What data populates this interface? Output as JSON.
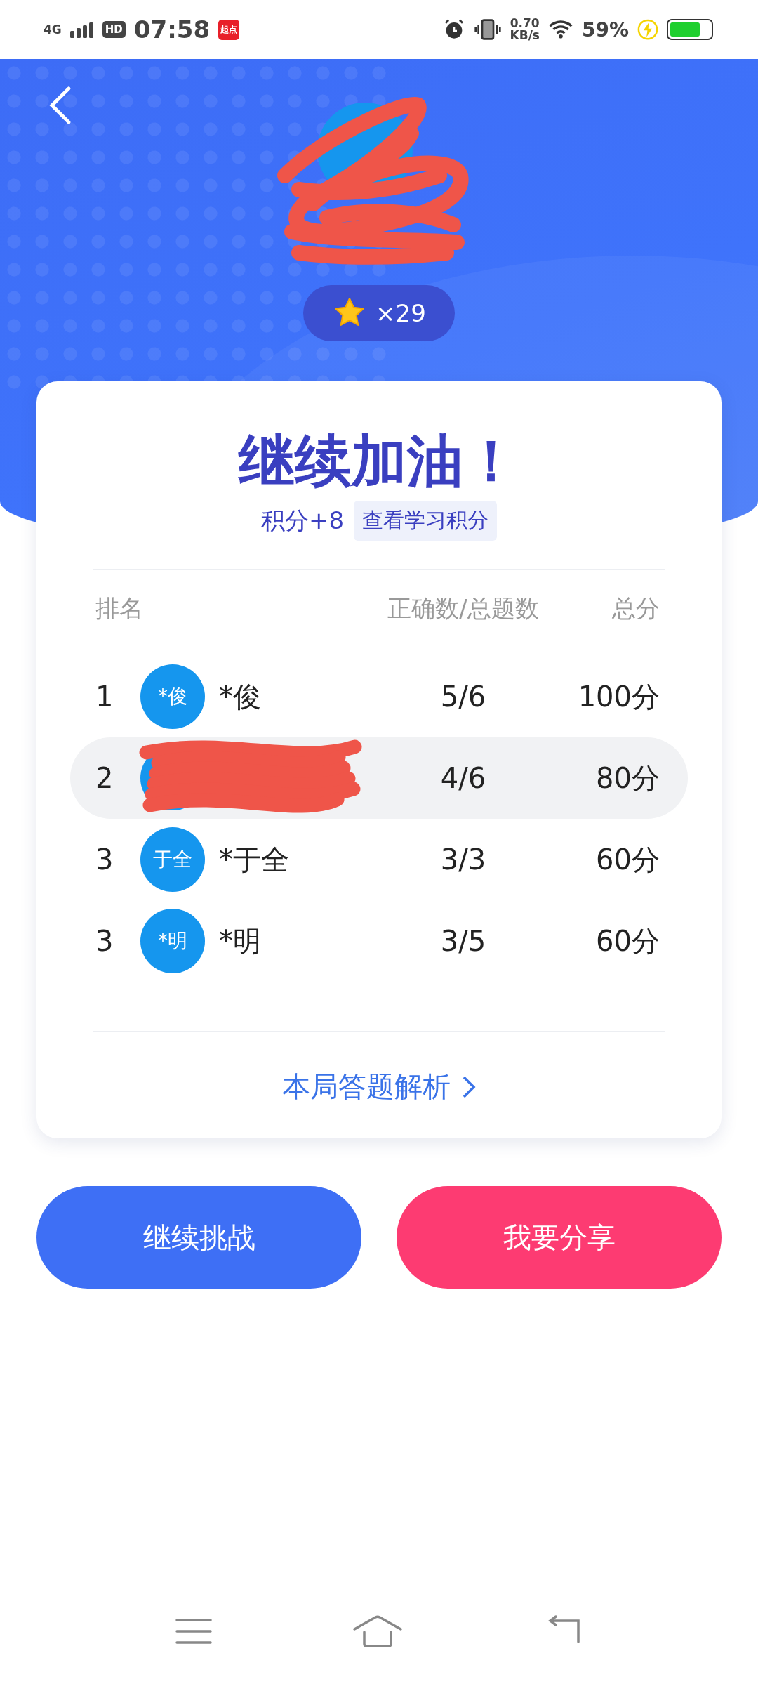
{
  "status_bar": {
    "network": "4G",
    "hd": "HD",
    "time": "07:58",
    "app_badge": "起点",
    "speed_value": "0.70",
    "speed_unit": "KB/s",
    "battery_percent": "59%",
    "charging": true
  },
  "profile": {
    "redacted": true,
    "stars_count": "×29"
  },
  "card": {
    "title": "继续加油！",
    "points": "积分+8",
    "points_link": "查看学习积分",
    "columns": [
      "排名",
      "正确数/总题数",
      "总分"
    ],
    "rows": [
      {
        "rank": "1",
        "avatar": "*俊",
        "name": "*俊",
        "correct": "5/6",
        "score": "100分",
        "selected": false,
        "redacted": false
      },
      {
        "rank": "2",
        "correct": "4/6",
        "score": "80分",
        "selected": true,
        "redacted": true
      },
      {
        "rank": "3",
        "avatar": "于全",
        "name": "*于全",
        "correct": "3/3",
        "score": "60分",
        "selected": false,
        "redacted": false
      },
      {
        "rank": "3",
        "avatar": "*明",
        "name": "*明",
        "correct": "3/5",
        "score": "60分",
        "selected": false,
        "redacted": false
      }
    ],
    "analysis_link": "本局答题解析"
  },
  "buttons": [
    {
      "label": "继续挑战",
      "kind": "primary"
    },
    {
      "label": "我要分享",
      "kind": "share"
    }
  ]
}
